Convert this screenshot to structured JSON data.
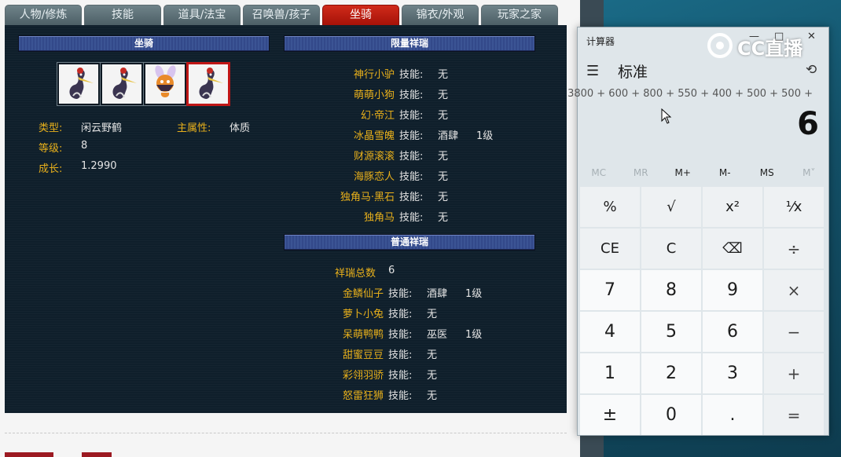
{
  "tabs": [
    "人物/修炼",
    "技能",
    "道具/法宝",
    "召唤兽/孩子",
    "坐骑",
    "锦衣/外观",
    "玩家之家"
  ],
  "mount_panel": {
    "header": "坐骑",
    "type_label": "类型:",
    "type_value": "闲云野鹤",
    "attr_label": "主属性:",
    "attr_value": "体质",
    "level_label": "等级:",
    "level_value": "8",
    "growth_label": "成长:",
    "growth_value": "1.2990",
    "slots": [
      "crane-icon",
      "crane-icon",
      "fox-spirit-icon",
      "crane-icon"
    ]
  },
  "limited_panel": {
    "header": "限量祥瑞",
    "rows": [
      {
        "name": "神行小驴",
        "skill_label": "技能:",
        "skill": "无",
        "level": ""
      },
      {
        "name": "萌萌小狗",
        "skill_label": "技能:",
        "skill": "无",
        "level": ""
      },
      {
        "name": "幻·帝江",
        "skill_label": "技能:",
        "skill": "无",
        "level": ""
      },
      {
        "name": "冰晶雪魄",
        "skill_label": "技能:",
        "skill": "酒肆",
        "level": "1级"
      },
      {
        "name": "财源滚滚",
        "skill_label": "技能:",
        "skill": "无",
        "level": ""
      },
      {
        "name": "海豚恋人",
        "skill_label": "技能:",
        "skill": "无",
        "level": ""
      },
      {
        "name": "独角马·黑石",
        "skill_label": "技能:",
        "skill": "无",
        "level": ""
      },
      {
        "name": "独角马",
        "skill_label": "技能:",
        "skill": "无",
        "level": ""
      }
    ]
  },
  "normal_panel": {
    "header": "普通祥瑞",
    "total_label": "祥瑞总数",
    "total_value": "6",
    "rows": [
      {
        "name": "金鳞仙子",
        "skill_label": "技能:",
        "skill": "酒肆",
        "level": "1级"
      },
      {
        "name": "萝卜小兔",
        "skill_label": "技能:",
        "skill": "无",
        "level": ""
      },
      {
        "name": "呆萌鸭鸭",
        "skill_label": "技能:",
        "skill": "巫医",
        "level": "1级"
      },
      {
        "name": "甜蜜豆豆",
        "skill_label": "技能:",
        "skill": "无",
        "level": ""
      },
      {
        "name": "彩翎羽骄",
        "skill_label": "技能:",
        "skill": "无",
        "level": ""
      },
      {
        "name": "怒雷狂狮",
        "skill_label": "技能:",
        "skill": "无",
        "level": ""
      }
    ]
  },
  "calculator": {
    "title": "计算器",
    "mode": "标准",
    "expression": "3800 + 600 + 800 + 550 + 400 + 500 + 500 +",
    "display": "6",
    "memory": [
      "MC",
      "MR",
      "M+",
      "M-",
      "MS",
      "M˅"
    ],
    "keys": [
      "%",
      "√",
      "x²",
      "¹⁄x",
      "CE",
      "C",
      "⌫",
      "÷",
      "7",
      "8",
      "9",
      "×",
      "4",
      "5",
      "6",
      "−",
      "1",
      "2",
      "3",
      "+",
      "±",
      "0",
      ".",
      "="
    ],
    "window_controls": [
      "—",
      "□",
      "✕"
    ]
  },
  "watermark": {
    "text": "CC直播"
  }
}
